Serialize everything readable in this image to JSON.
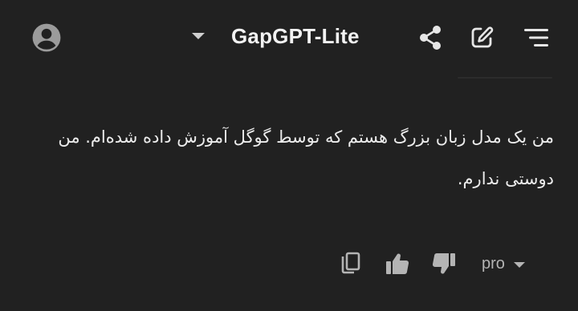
{
  "header": {
    "model_name": "GapGPT-Lite",
    "icons": [
      "account-circle-icon",
      "chevron-down-icon",
      "share-icon",
      "new-chat-icon",
      "menu-icon"
    ]
  },
  "message": {
    "text": "من یک مدل زبان بزرگ هستم که توسط گوگل آموزش داده شده‌ام. من دوستی ندارم."
  },
  "actions": {
    "icons": [
      "copy-icon",
      "thumbs-up-icon",
      "thumbs-down-icon"
    ],
    "model_select_label": "pro"
  },
  "colors": {
    "background": "#212121",
    "text": "#ececec",
    "icon": "#e6e6e6",
    "muted_icon": "#b4b4b4",
    "avatar": "#9b9b9b"
  }
}
